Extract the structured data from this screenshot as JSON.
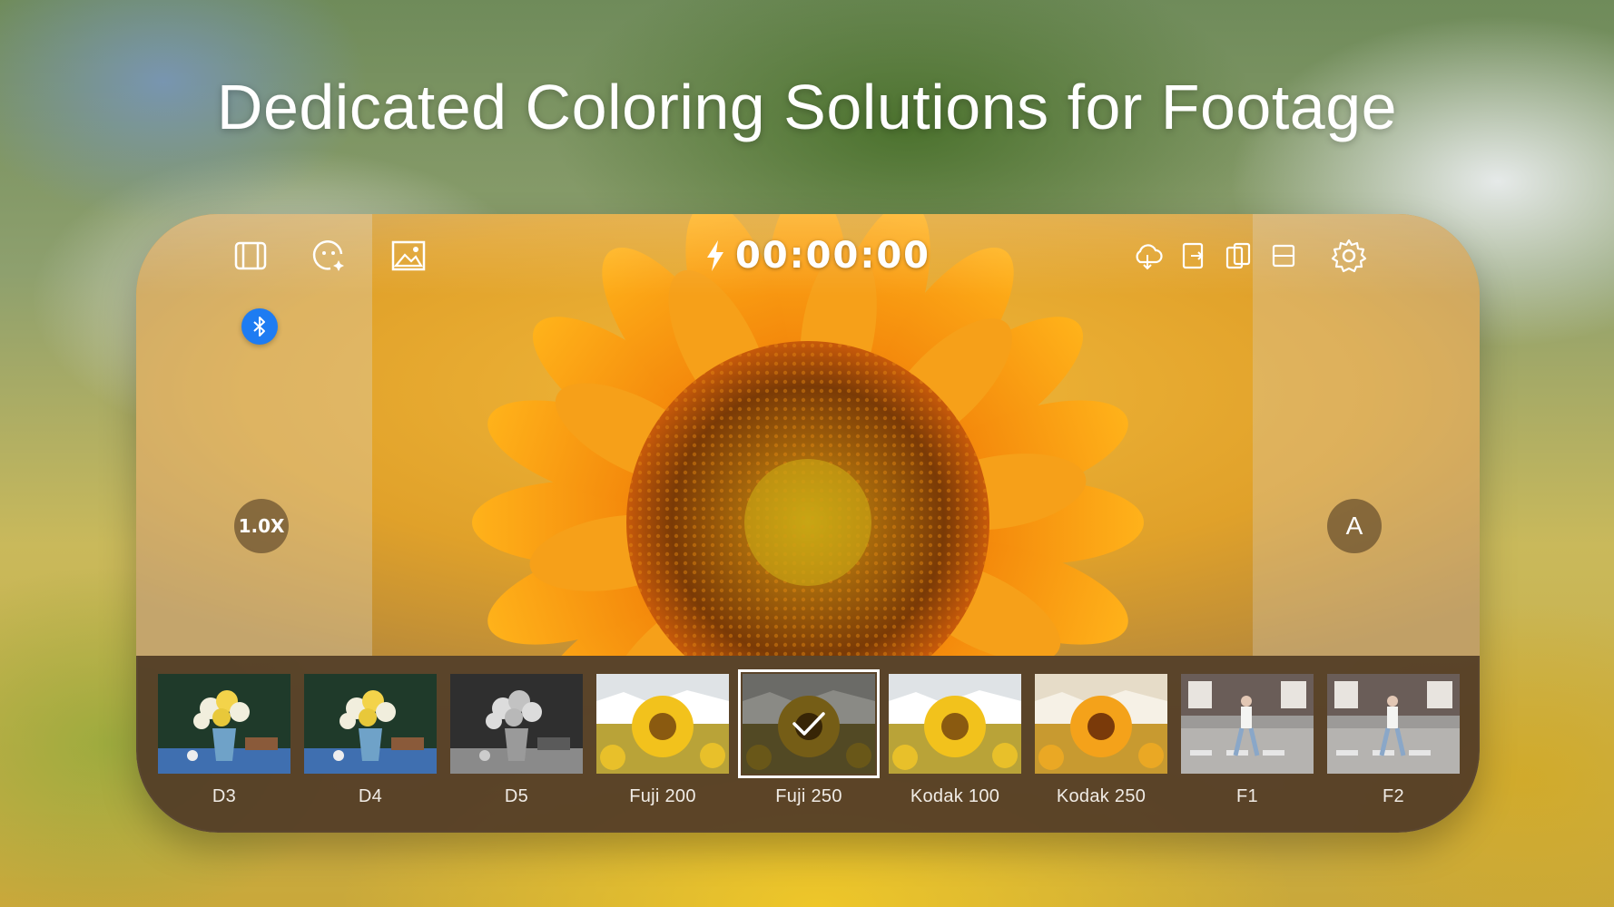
{
  "headline": "Dedicated Coloring Solutions for Footage",
  "toolbar": {
    "left_icons": [
      "film-frame-icon",
      "face-effects-icon",
      "gallery-icon"
    ],
    "right_icons": [
      "cloud-icon",
      "import-icon",
      "copy-icon",
      "aspect-ratio-icon",
      "settings-icon"
    ]
  },
  "recording": {
    "timer": "00:00:00",
    "flash_icon": "lightning-icon"
  },
  "bluetooth": {
    "icon": "bluetooth-icon",
    "color": "#1e7cf2"
  },
  "zoom": {
    "label": "1.0X"
  },
  "auto_mode": {
    "label": "A"
  },
  "filters": {
    "selected": "Fuji 250",
    "items": [
      {
        "label": "D3",
        "scene": "flowers-green"
      },
      {
        "label": "D4",
        "scene": "flowers-green"
      },
      {
        "label": "D5",
        "scene": "flowers-mono"
      },
      {
        "label": "Fuji 200",
        "scene": "sunflower"
      },
      {
        "label": "Fuji 250",
        "scene": "sunflower-dark"
      },
      {
        "label": "Kodak 100",
        "scene": "sunflower"
      },
      {
        "label": "Kodak 250",
        "scene": "sunflower-warm"
      },
      {
        "label": "F1",
        "scene": "street"
      },
      {
        "label": "F2",
        "scene": "street"
      }
    ]
  }
}
